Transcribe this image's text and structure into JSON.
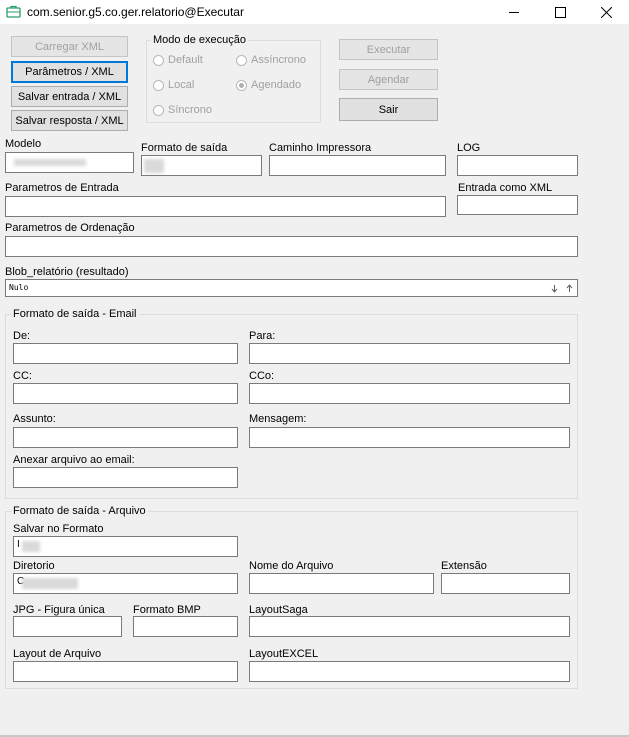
{
  "window": {
    "title": "com.senior.g5.co.ger.relatorio@Executar",
    "minimize": "—",
    "maximize": "☐",
    "close": "✕"
  },
  "buttons": {
    "carregar_xml": "Carregar XML",
    "parametros_xml": "Parâmetros / XML",
    "salvar_entrada": "Salvar entrada / XML",
    "salvar_resposta": "Salvar resposta / XML",
    "executar": "Executar",
    "agendar": "Agendar",
    "sair": "Sair"
  },
  "modo": {
    "title": "Modo de execução",
    "default": "Default",
    "assincrono": "Assíncrono",
    "local": "Local",
    "agendado": "Agendado",
    "sincrono": "Síncrono",
    "selected": "Agendado"
  },
  "fields": {
    "modelo": "Modelo",
    "formato_saida": "Formato de saída",
    "caminho_impressora": "Caminho Impressora",
    "log": "LOG",
    "parametros_entrada": "Parametros de Entrada",
    "entrada_xml": "Entrada como XML",
    "parametros_ordenacao": "Parametros de Ordenação",
    "blob": "Blob_relatório (resultado)",
    "blob_value": "Nulo"
  },
  "email": {
    "title": "Formato de saída - Email",
    "de": "De:",
    "para": "Para:",
    "cc": "CC:",
    "cco": "CCo:",
    "assunto": "Assunto:",
    "mensagem": "Mensagem:",
    "anexar": "Anexar arquivo ao email:"
  },
  "arquivo": {
    "title": "Formato de saída - Arquivo",
    "salvar_formato": "Salvar no Formato",
    "salvar_formato_value": "I",
    "diretorio": "Diretorio",
    "diretorio_value": "C",
    "nome_arquivo": "Nome do Arquivo",
    "extensao": "Extensão",
    "jpg": "JPG - Figura única",
    "bmp": "Formato BMP",
    "layout_saga": "LayoutSaga",
    "layout_arquivo": "Layout de Arquivo",
    "layout_excel": "LayoutEXCEL"
  }
}
